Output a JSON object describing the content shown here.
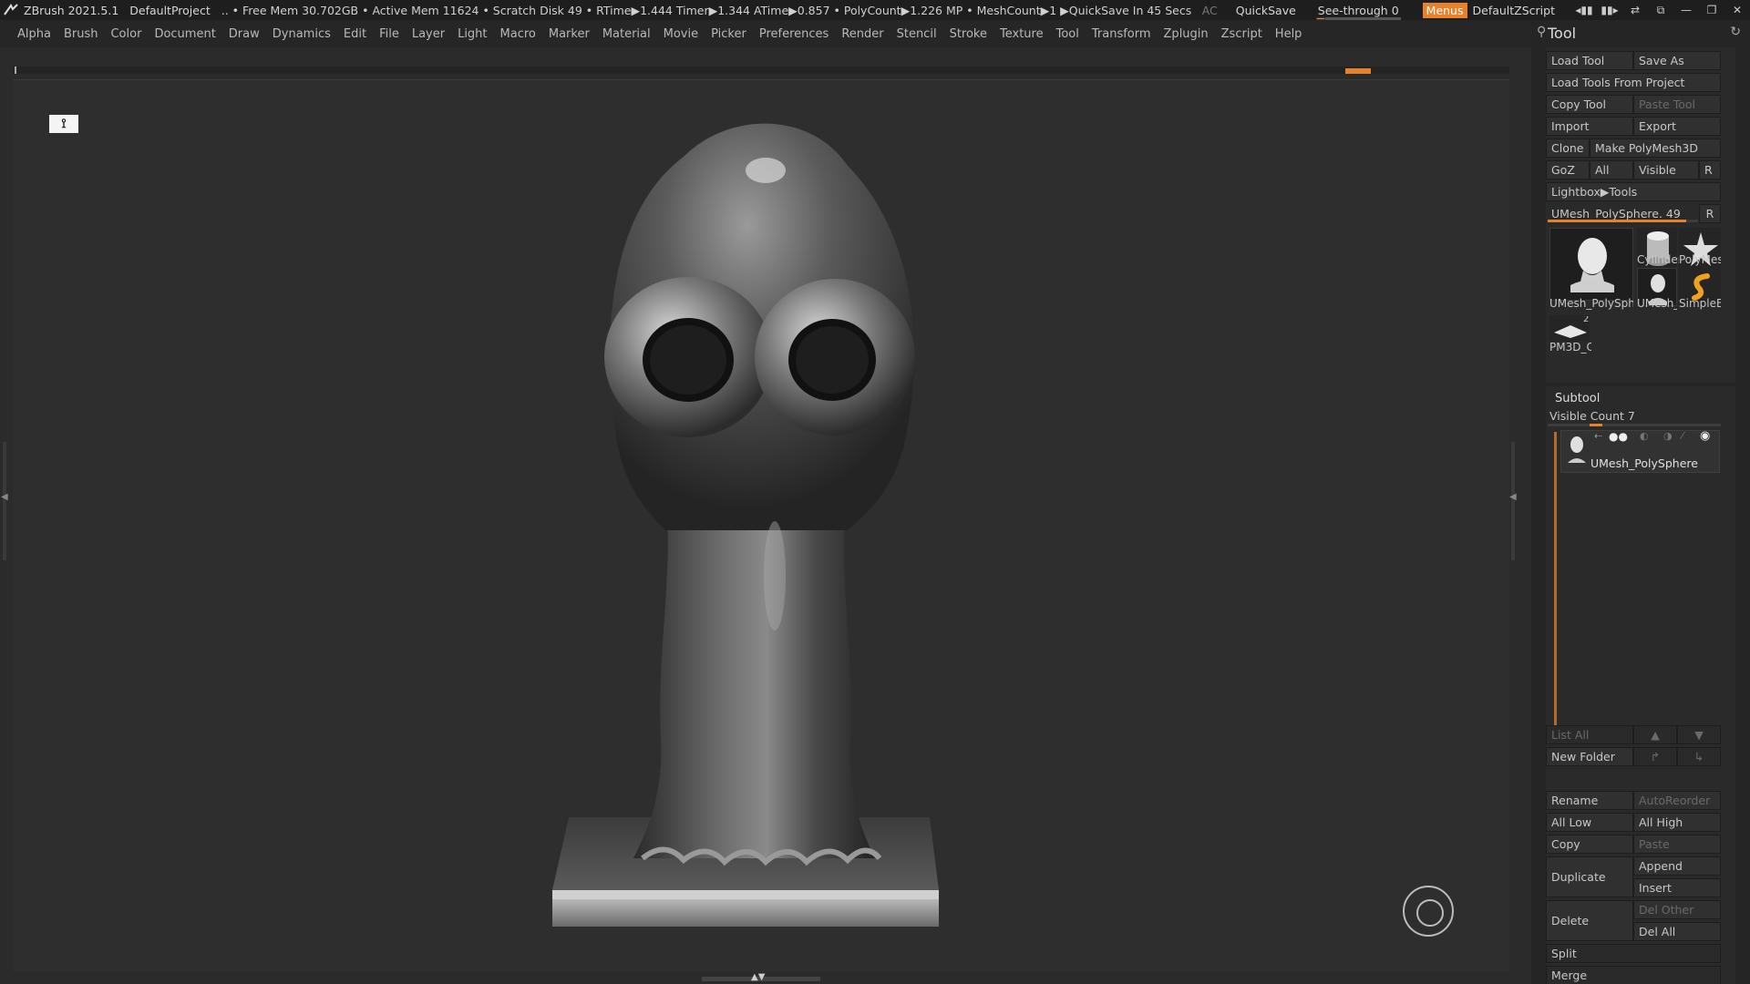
{
  "titlebar": {
    "app": "ZBrush 2021.5.1",
    "project": "DefaultProject",
    "status": ".. • Free Mem 30.702GB • Active Mem 11624 • Scratch Disk 49 •  RTime▶1.444 Timer▶1.344 ATime▶0.857 • PolyCount▶1.226 MP  • MeshCount▶1  ▶QuickSave In 45 Secs",
    "ac": "AC",
    "quicksave": "QuickSave",
    "seethrough": "See-through  0",
    "seethrough_value": 0,
    "menus": "Menus",
    "script": "DefaultZScript"
  },
  "menubar": {
    "items": [
      "Alpha",
      "Brush",
      "Color",
      "Document",
      "Draw",
      "Dynamics",
      "Edit",
      "File",
      "Layer",
      "Light",
      "Macro",
      "Marker",
      "Material",
      "Movie",
      "Picker",
      "Preferences",
      "Render",
      "Stencil",
      "Stroke",
      "Texture",
      "Tool",
      "Transform",
      "Zplugin",
      "Zscript",
      "Help"
    ]
  },
  "toolpanel": {
    "title": "Tool",
    "load_tool": "Load Tool",
    "save_as": "Save As",
    "load_from_project": "Load Tools From Project",
    "copy_tool": "Copy Tool",
    "paste_tool": "Paste Tool",
    "import": "Import",
    "export": "Export",
    "clone": "Clone",
    "make_polymesh": "Make PolyMesh3D",
    "goz": "GoZ",
    "all": "All",
    "visible": "Visible",
    "r": "R",
    "lightbox_tools": "Lightbox▶Tools",
    "current_tool": "UMesh_PolySphere. 49",
    "current_tool_r": "R",
    "tool_slider_fraction": 0.92,
    "thumbnails": [
      {
        "label": "UMesh_PolySphe",
        "icon": "head-bust-icon"
      },
      {
        "label": "Cylinder",
        "icon": "cylinder-icon"
      },
      {
        "label": "PolyMes",
        "icon": "star-icon"
      },
      {
        "label": "UMesh_",
        "icon": "head-bust-icon"
      },
      {
        "label": "SimpleB",
        "icon": "simple-brush-icon"
      },
      {
        "label": "PM3D_C",
        "icon": "plane-icon"
      }
    ],
    "pm3d_count": "2"
  },
  "subtool": {
    "title": "Subtool",
    "visible_count": "Visible Count 7",
    "visible_count_fraction": 0.25,
    "item_name": "UMesh_PolySphere",
    "list_all": "List All",
    "new_folder": "New Folder",
    "rename": "Rename",
    "autoreorder": "AutoReorder",
    "all_low": "All Low",
    "all_high": "All High",
    "copy": "Copy",
    "paste": "Paste",
    "duplicate": "Duplicate",
    "append": "Append",
    "insert": "Insert",
    "delete": "Delete",
    "del_other": "Del Other",
    "del_all": "Del All",
    "split": "Split",
    "merge": "Merge"
  }
}
